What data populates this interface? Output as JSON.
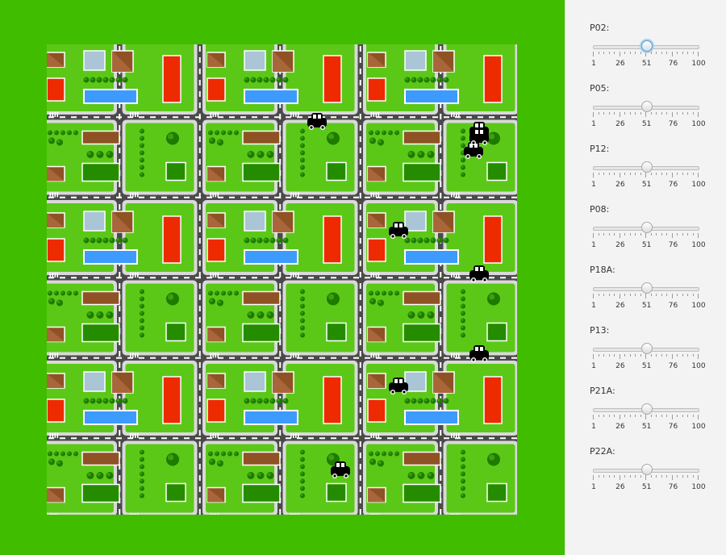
{
  "sliders": [
    {
      "label": "P02:",
      "value": 51,
      "focused": true
    },
    {
      "label": "P05:",
      "value": 51,
      "focused": false
    },
    {
      "label": "P12:",
      "value": 51,
      "focused": false
    },
    {
      "label": "P08:",
      "value": 51,
      "focused": false
    },
    {
      "label": "P18A:",
      "value": 51,
      "focused": false
    },
    {
      "label": "P13:",
      "value": 51,
      "focused": false
    },
    {
      "label": "P21A:",
      "value": 51,
      "focused": false
    },
    {
      "label": "P22A:",
      "value": 51,
      "focused": false
    }
  ],
  "slider_scale": {
    "min": 1,
    "max": 100,
    "tick_labels": [
      "1",
      "26",
      "51",
      "76",
      "100"
    ]
  },
  "colors": {
    "background": "#41bd00",
    "road": "#4a4a4a",
    "sidewalk": "#d9d9d9",
    "lawn": "#5bc818",
    "dark_lawn": "#258c00",
    "red_roof": "#ee2a00",
    "brown_roof": "#8f5224",
    "pool": "#3d9bff",
    "car": "#000000"
  },
  "map": {
    "columns": 6,
    "rows": 6,
    "block_patterns": [
      "house-pool",
      "park",
      "house-pool",
      "park",
      "house-pool",
      "park"
    ],
    "cars": 9
  }
}
